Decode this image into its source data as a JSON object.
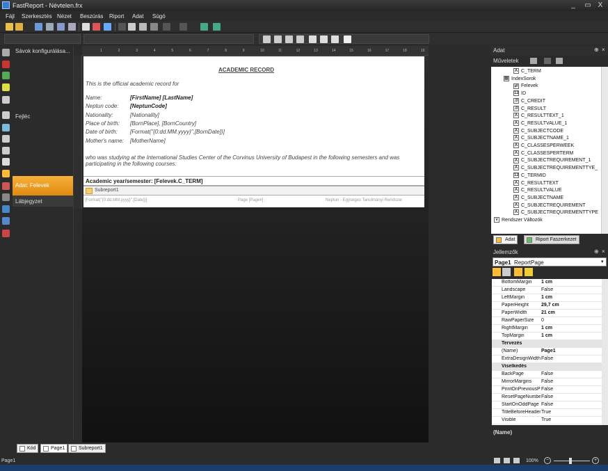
{
  "window": {
    "title": "FastReport - Névtelen.frx",
    "min": "_",
    "max": "▭",
    "close": "X"
  },
  "menu": [
    "Fájl",
    "Szerkesztés",
    "Nézet",
    "Beszúrás",
    "Riport",
    "Adat",
    "Súgó"
  ],
  "bands": {
    "configure": "Sávok konfigurálása...",
    "header": "Fejléc",
    "data": "Adat: Felevek",
    "footer": "Lábjegyzet"
  },
  "ruler": [
    "1",
    "2",
    "3",
    "4",
    "5",
    "6",
    "7",
    "8",
    "9",
    "10",
    "11",
    "12",
    "13",
    "14",
    "15",
    "16",
    "17",
    "18",
    "19"
  ],
  "report": {
    "title": "ACADEMIC RECORD",
    "intro": "This is the official academic record for",
    "fields": [
      {
        "label": "Name:",
        "value": "[FirstName] [LastName]",
        "bold": true
      },
      {
        "label": "Neptun code:",
        "value": "[NeptunCode]",
        "bold": true
      },
      {
        "label": "Nationality:",
        "value": "[Nationality]",
        "bold": false
      },
      {
        "label": "Place of birth:",
        "value": "[BornPlace], [BornCountry]",
        "bold": false
      },
      {
        "label": "Date of birth:",
        "value": "[Format(\"{0:dd.MM.yyyy}\",[BornDate])]",
        "bold": false
      },
      {
        "label": "Mother's name:",
        "value": "[MotherName]",
        "bold": false
      }
    ],
    "studying_line1": "who was studying at the International Studies Center of the Corvinus University of Budapest in the following semesters and was",
    "studying_line2": "participating in the following courses:",
    "semester": "Academic year/semester: [Felevek.C_TERM]",
    "subreport": "Subreport1",
    "footer_left": "[Format(\"{0:dd.MM.yyyy}\",[Date])]",
    "footer_mid": "Page [Page#]",
    "footer_right": "Neptun - Egységes Tanulmányi Rendszer"
  },
  "data_panel": {
    "title": "Adat",
    "actions": "Műveletek",
    "items": [
      {
        "label": "C_TERM",
        "icon": "A",
        "indent": 2
      },
      {
        "label": "IndexSorok",
        "icon": "table",
        "indent": 1
      },
      {
        "label": "Felevek",
        "icon": "rel",
        "indent": 2
      },
      {
        "label": "ID",
        "icon": "12",
        "indent": 2
      },
      {
        "label": "C_CREDIT",
        "icon": ".0",
        "indent": 2
      },
      {
        "label": "C_RESULT",
        "icon": ".0",
        "indent": 2
      },
      {
        "label": "C_RESULTTEXT_1",
        "icon": "A",
        "indent": 2
      },
      {
        "label": "C_RESULTVALUE_1",
        "icon": "A",
        "indent": 2
      },
      {
        "label": "C_SUBJECTCODE",
        "icon": "A",
        "indent": 2
      },
      {
        "label": "C_SUBJECTNAME_1",
        "icon": "A",
        "indent": 2
      },
      {
        "label": "C_CLASSESPERWEEK",
        "icon": "A",
        "indent": 2
      },
      {
        "label": "C_CLASSESPERTERM",
        "icon": "A",
        "indent": 2
      },
      {
        "label": "C_SUBJECTREQUIREMENT_1",
        "icon": "A",
        "indent": 2
      },
      {
        "label": "C_SUBJECTREQUIREMENTTYE_",
        "icon": "A",
        "indent": 2
      },
      {
        "label": "C_TERMID",
        "icon": "12",
        "indent": 2
      },
      {
        "label": "C_RESULTTEXT",
        "icon": "A",
        "indent": 2
      },
      {
        "label": "C_RESULTVALUE",
        "icon": "A",
        "indent": 2
      },
      {
        "label": "C_SUBJECTNAME",
        "icon": "A",
        "indent": 2
      },
      {
        "label": "C_SUBJECTREQUIREMENT",
        "icon": "A",
        "indent": 2
      },
      {
        "label": "C_SUBJECTREQUIREMENTTYPE",
        "icon": "A",
        "indent": 2
      },
      {
        "label": "Rendszer Változók",
        "icon": "sys",
        "indent": 0
      }
    ],
    "tab_data": "Adat",
    "tab_structure": "Riport Faszerkezet"
  },
  "props_panel": {
    "title": "Jellemzők",
    "object": "Page1",
    "object_type": "ReportPage",
    "rows": [
      {
        "name": "BottomMargin",
        "value": "1 cm",
        "bold": true
      },
      {
        "name": "Landscape",
        "value": "False"
      },
      {
        "name": "LeftMargin",
        "value": "1 cm",
        "bold": true
      },
      {
        "name": "PaperHeight",
        "value": "29,7 cm",
        "bold": true
      },
      {
        "name": "PaperWidth",
        "value": "21 cm",
        "bold": true
      },
      {
        "name": "RawPaperSize",
        "value": "0"
      },
      {
        "name": "RightMargin",
        "value": "1 cm",
        "bold": true
      },
      {
        "name": "TopMargin",
        "value": "1 cm",
        "bold": true
      },
      {
        "name": "Tervezés",
        "value": "",
        "cat": true
      },
      {
        "name": "(Name)",
        "value": "Page1",
        "bold": true
      },
      {
        "name": "ExtraDesignWidth",
        "value": "False"
      },
      {
        "name": "Viselkedés",
        "value": "",
        "cat": true
      },
      {
        "name": "BackPage",
        "value": "False"
      },
      {
        "name": "MirrorMargins",
        "value": "False"
      },
      {
        "name": "PrintOnPreviousPage",
        "value": "False"
      },
      {
        "name": "ResetPageNumber",
        "value": "False"
      },
      {
        "name": "StartOnOddPage",
        "value": "False"
      },
      {
        "name": "TitleBeforeHeader",
        "value": "True"
      },
      {
        "name": "Visible",
        "value": "True"
      }
    ],
    "description": "(Name)"
  },
  "bottom_tabs": [
    "Kód",
    "Page1",
    "Subreport1"
  ],
  "status": {
    "page": "Page1",
    "zoom": "100%"
  }
}
